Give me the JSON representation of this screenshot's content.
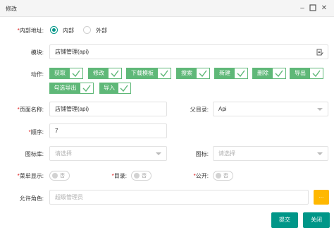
{
  "window": {
    "title": "修改",
    "minimize_icon": "minimize-icon",
    "maximize_icon": "maximize-icon",
    "close_icon": "close-icon"
  },
  "form": {
    "address": {
      "label": "内部地址:",
      "options": [
        "内部",
        "外部"
      ],
      "selected": "内部"
    },
    "module": {
      "label": "模块:",
      "value": "店铺管理(api)"
    },
    "actions": {
      "label": "动作:",
      "items": [
        "获取",
        "修改",
        "下载模板",
        "搜索",
        "新建",
        "删除",
        "导出",
        "勾选导出",
        "导入"
      ]
    },
    "page_name": {
      "label": "页面名称:",
      "value": "店铺管理(api)"
    },
    "parent_dir": {
      "label": "父目录:",
      "value": "Api"
    },
    "order": {
      "label": "顺序:",
      "value": "7"
    },
    "icon_lib": {
      "label": "图标库:",
      "placeholder": "请选择"
    },
    "icon": {
      "label": "图标:",
      "placeholder": "请选择"
    },
    "menu_show": {
      "label": "菜单显示:",
      "state": "否"
    },
    "directory": {
      "label": "目录:",
      "state": "否"
    },
    "public": {
      "label": "公开:",
      "state": "否"
    },
    "roles": {
      "label": "允许角色:",
      "placeholder": "超级管理员",
      "button": "..."
    }
  },
  "footer": {
    "submit": "提交",
    "close": "关闭"
  },
  "colors": {
    "primary": "#009688",
    "check_green": "#5fb878",
    "accent_yellow": "#ffb800",
    "required_red": "#e02020"
  }
}
